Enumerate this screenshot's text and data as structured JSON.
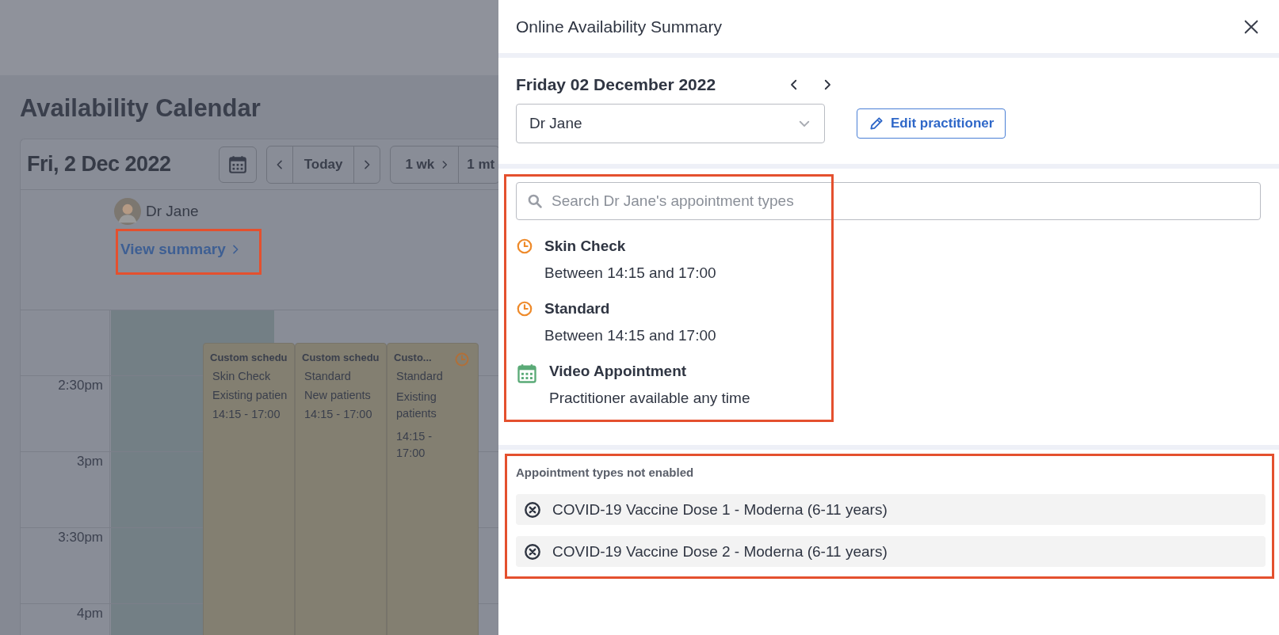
{
  "calendar": {
    "title": "Availability Calendar",
    "date": "Fri, 2 Dec 2022",
    "today_button": "Today",
    "view_buttons": [
      "1 wk",
      "1 mt"
    ],
    "practitioner": "Dr Jane",
    "view_summary_link": "View summary",
    "times": [
      "2:30pm",
      "3pm",
      "3:30pm",
      "4pm"
    ],
    "events": [
      {
        "title": "Custom schedu",
        "type": "Skin Check",
        "patients": "Existing patien",
        "time": "14:15 - 17:00",
        "clock": false
      },
      {
        "title": "Custom schedu",
        "type": "Standard",
        "patients": "New patients",
        "time": "14:15 - 17:00",
        "clock": false
      },
      {
        "title": "Custo...",
        "type": "Standard",
        "patients": "Existing patients",
        "time": "14:15 - 17:00",
        "clock": true
      }
    ]
  },
  "panel": {
    "title": "Online Availability Summary",
    "date": "Friday 02 December 2022",
    "practitioner_select": "Dr Jane",
    "edit_button": "Edit practitioner",
    "search": {
      "placeholder": "Search Dr Jane's appointment types"
    },
    "appointment_types": [
      {
        "kind": "scheduled",
        "name": "Skin Check",
        "detail": "Between 14:15 and 17:00"
      },
      {
        "kind": "scheduled",
        "name": "Standard",
        "detail": "Between 14:15 and 17:00"
      },
      {
        "kind": "anytime",
        "name": "Video Appointment",
        "detail": "Practitioner available any time"
      }
    ],
    "not_enabled_heading": "Appointment types not enabled",
    "not_enabled": [
      "COVID-19 Vaccine Dose 1 - Moderna (6-11 years)",
      "COVID-19 Vaccine Dose 2 - Moderna (6-11 years)"
    ]
  }
}
